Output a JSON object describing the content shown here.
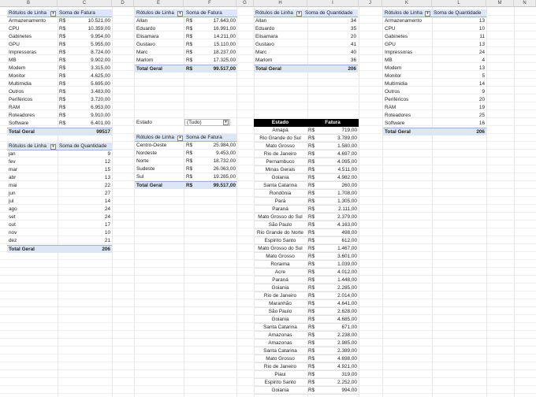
{
  "columns": [
    "B",
    "C",
    "D",
    "E",
    "F",
    "G",
    "H",
    "I",
    "J",
    "K",
    "L",
    "M",
    "N"
  ],
  "pivot_categoria_fatura": {
    "header_label": "Rótulos de Linha",
    "header_value": "Soma de Fatura",
    "rows": [
      [
        "Armazenamento",
        "R$",
        "10.521,00"
      ],
      [
        "CPU",
        "R$",
        "10.359,00"
      ],
      [
        "Gabinetes",
        "R$",
        "9.954,00"
      ],
      [
        "GPU",
        "R$",
        "5.955,00"
      ],
      [
        "Impressoras",
        "R$",
        "8.724,00"
      ],
      [
        "MB",
        "R$",
        "9.902,00"
      ],
      [
        "Modem",
        "R$",
        "3.315,00"
      ],
      [
        "Monitor",
        "R$",
        "4.625,00"
      ],
      [
        "Multimidia",
        "R$",
        "5.695,00"
      ],
      [
        "Outros",
        "R$",
        "3.483,00"
      ],
      [
        "Periféricos",
        "R$",
        "3.720,00"
      ],
      [
        "RAM",
        "R$",
        "6.953,00"
      ],
      [
        "Roteadores",
        "R$",
        "9.910,00"
      ],
      [
        "Software",
        "R$",
        "6.401,00"
      ]
    ],
    "total_label": "Total Geral",
    "total_value": "99517"
  },
  "pivot_mes_quantidade": {
    "header_label": "Rótulos de Linha",
    "header_value": "Soma de Quantidade",
    "rows": [
      [
        "jan",
        "9"
      ],
      [
        "fev",
        "12"
      ],
      [
        "mar",
        "15"
      ],
      [
        "abr",
        "13"
      ],
      [
        "mai",
        "22"
      ],
      [
        "jun",
        "27"
      ],
      [
        "jul",
        "14"
      ],
      [
        "ago",
        "24"
      ],
      [
        "set",
        "24"
      ],
      [
        "out",
        "17"
      ],
      [
        "nov",
        "10"
      ],
      [
        "dez",
        "21"
      ]
    ],
    "total_label": "Total Geral",
    "total_value": "206"
  },
  "pivot_vendedor_fatura": {
    "header_label": "Rótulos de Linha",
    "header_value": "Soma de Fatura",
    "rows": [
      [
        "Allan",
        "R$",
        "17.643,00"
      ],
      [
        "Eduardo",
        "R$",
        "16.991,00"
      ],
      [
        "Elisamara",
        "R$",
        "14.211,00"
      ],
      [
        "Gustavo",
        "R$",
        "15.110,00"
      ],
      [
        "Marc",
        "R$",
        "18.237,00"
      ],
      [
        "Marlom",
        "R$",
        "17.325,00"
      ]
    ],
    "total_label": "Total Geral",
    "total_currency": "R$",
    "total_value": "99.517,00"
  },
  "filter": {
    "label": "Estado",
    "value": "(Tudo)"
  },
  "pivot_regiao_fatura": {
    "header_label": "Rótulos de Linha",
    "header_value": "Soma de Fatura",
    "rows": [
      [
        "Centro-Oeste",
        "R$",
        "25.984,00"
      ],
      [
        "Nordeste",
        "R$",
        "9.453,00"
      ],
      [
        "Norte",
        "R$",
        "18.732,00"
      ],
      [
        "Sudeste",
        "R$",
        "26.063,00"
      ],
      [
        "Sul",
        "R$",
        "19.285,00"
      ]
    ],
    "total_label": "Total Geral",
    "total_currency": "R$",
    "total_value": "99.517,00"
  },
  "pivot_vendedor_quantidade": {
    "header_label": "Rótulos de Linha",
    "header_value": "Soma de Quantidade",
    "rows": [
      [
        "Allan",
        "34"
      ],
      [
        "Eduardo",
        "35"
      ],
      [
        "Elisamara",
        "20"
      ],
      [
        "Gustavo",
        "41"
      ],
      [
        "Marc",
        "40"
      ],
      [
        "Marlom",
        "36"
      ]
    ],
    "total_label": "Total Geral",
    "total_value": "206"
  },
  "pivot_categoria_quantidade": {
    "header_label": "Rótulos de Linha",
    "header_value": "Soma de Quantidade",
    "rows": [
      [
        "Armazenamento",
        "13"
      ],
      [
        "CPU",
        "10"
      ],
      [
        "Gabinetes",
        "11"
      ],
      [
        "GPU",
        "13"
      ],
      [
        "Impressoras",
        "24"
      ],
      [
        "MB",
        "4"
      ],
      [
        "Modem",
        "13"
      ],
      [
        "Monitor",
        "5"
      ],
      [
        "Multimidia",
        "14"
      ],
      [
        "Outros",
        "9"
      ],
      [
        "Periféricos",
        "20"
      ],
      [
        "RAM",
        "19"
      ],
      [
        "Roteadores",
        "25"
      ],
      [
        "Software",
        "16"
      ]
    ],
    "total_label": "Total Geral",
    "total_value": "206"
  },
  "estado_table": {
    "header_estado": "Estado",
    "header_fatura": "Fatura",
    "rows": [
      [
        "Amapá",
        "R$",
        "719,00"
      ],
      [
        "Rio Grande do Sul",
        "R$",
        "3.789,00"
      ],
      [
        "Mato Grosso",
        "R$",
        "1.580,00"
      ],
      [
        "Rio de Janeiro",
        "R$",
        "4.697,00"
      ],
      [
        "Pernambuco",
        "R$",
        "4.095,00"
      ],
      [
        "Minas Gerais",
        "R$",
        "4.511,00"
      ],
      [
        "Goiania",
        "R$",
        "4.982,00"
      ],
      [
        "Santa Catarina",
        "R$",
        "260,00"
      ],
      [
        "Rondônia",
        "R$",
        "1.708,00"
      ],
      [
        "Pará",
        "R$",
        "1.305,00"
      ],
      [
        "Paraná",
        "R$",
        "2.111,00"
      ],
      [
        "Mato Grosso do Sul",
        "R$",
        "2.379,00"
      ],
      [
        "São Paulo",
        "R$",
        "4.163,00"
      ],
      [
        "Rio Grande do Norte",
        "R$",
        "498,00"
      ],
      [
        "Espirito Santo",
        "R$",
        "612,00"
      ],
      [
        "Mato Grosso do Sul",
        "R$",
        "1.467,00"
      ],
      [
        "Mato Grosso",
        "R$",
        "3.601,00"
      ],
      [
        "Roraima",
        "R$",
        "1.039,00"
      ],
      [
        "Acre",
        "R$",
        "4.012,00"
      ],
      [
        "Paraná",
        "R$",
        "1.448,00"
      ],
      [
        "Goiania",
        "R$",
        "2.285,00"
      ],
      [
        "Rio de Janeiro",
        "R$",
        "2.014,00"
      ],
      [
        "Maranhão",
        "R$",
        "4.641,00"
      ],
      [
        "São Paulo",
        "R$",
        "2.628,00"
      ],
      [
        "Goiania",
        "R$",
        "4.685,00"
      ],
      [
        "Santa Catarina",
        "R$",
        "671,00"
      ],
      [
        "Amazonas",
        "R$",
        "2.238,00"
      ],
      [
        "Amazonas",
        "R$",
        "2.985,00"
      ],
      [
        "Santa Catarina",
        "R$",
        "2.389,00"
      ],
      [
        "Mato Grosso",
        "R$",
        "4.698,00"
      ],
      [
        "Rio de Janeiro",
        "R$",
        "4.921,00"
      ],
      [
        "Piaui",
        "R$",
        "319,00"
      ],
      [
        "Espirito Santo",
        "R$",
        "2.252,00"
      ],
      [
        "Goiania",
        "R$",
        "994,00"
      ]
    ]
  }
}
